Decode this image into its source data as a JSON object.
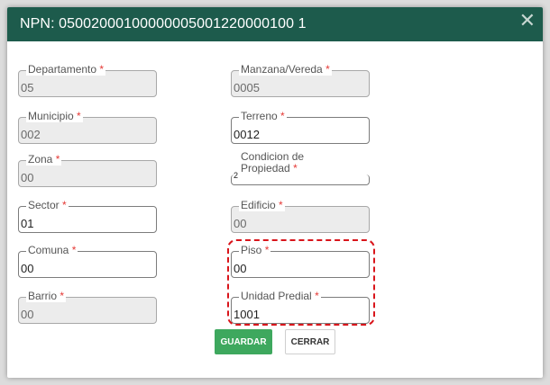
{
  "modal": {
    "title": "NPN: 05002000100000005001220000100 1",
    "close_icon": "close-icon"
  },
  "fields": {
    "departamento": {
      "label": "Departamento",
      "required": "*",
      "value": "05"
    },
    "municipio": {
      "label": "Municipio",
      "required": "*",
      "value": "002"
    },
    "zona": {
      "label": "Zona",
      "required": "*",
      "value": "00"
    },
    "sector": {
      "label": "Sector",
      "required": "*",
      "value": "01"
    },
    "comuna": {
      "label": "Comuna",
      "required": "*",
      "value": "00"
    },
    "barrio": {
      "label": "Barrio",
      "required": "*",
      "value": "00"
    },
    "manzana": {
      "label": "Manzana/Vereda",
      "required": "*",
      "value": "0005"
    },
    "terreno": {
      "label": "Terreno",
      "required": "*",
      "value": "0012"
    },
    "condicion": {
      "label": "Condicion de Propiedad",
      "required": "*",
      "value": "2"
    },
    "edificio": {
      "label": "Edificio",
      "required": "*",
      "value": "00"
    },
    "piso": {
      "label": "Piso",
      "required": "*",
      "value": "00"
    },
    "unidad": {
      "label": "Unidad Predial",
      "required": "*",
      "value": "1001"
    }
  },
  "buttons": {
    "save_label": "GUARDAR",
    "cancel_label": "CERRAR"
  },
  "colors": {
    "header": "#1d5b4c",
    "save": "#3ea85e",
    "required": "#e53935",
    "highlight": "#d9151b"
  }
}
